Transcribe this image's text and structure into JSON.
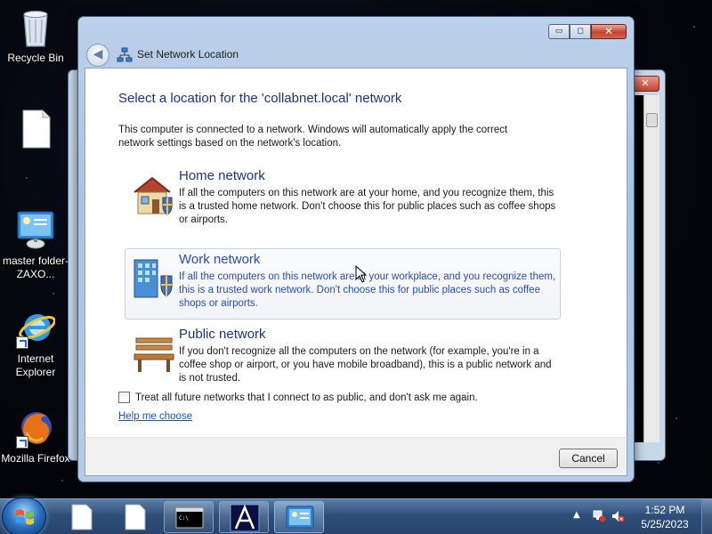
{
  "desktop": {
    "icons": [
      {
        "label": "Recycle Bin",
        "icon": "recycle-bin-icon"
      },
      {
        "label": "",
        "icon": "file-icon"
      },
      {
        "label": "master folder-ZAXO...",
        "icon": "network-folder-icon"
      },
      {
        "label": "Internet Explorer",
        "icon": "internet-explorer-icon"
      },
      {
        "label": "Mozilla Firefox",
        "icon": "firefox-icon"
      }
    ]
  },
  "background_window": {
    "close_label": "✕"
  },
  "dialog": {
    "title": "Set Network Location",
    "heading": "Select a location for the 'collabnet.local' network",
    "intro": "This computer is connected to a network. Windows will automatically apply the correct network settings based on the network's location.",
    "options": [
      {
        "title": "Home network",
        "description": "If all the computers on this network are at your home, and you recognize them, this is a trusted home network.  Don't choose this for public places such as coffee shops or airports.",
        "icon": "home-network-icon"
      },
      {
        "title": "Work network",
        "description": "If all the computers on this network are at your workplace, and you recognize them, this is a trusted work network.  Don't choose this for public places such as coffee shops or airports.",
        "icon": "work-network-icon",
        "state": "hover"
      },
      {
        "title": "Public network",
        "description": "If you don't recognize all the computers on the network (for example, you're in a coffee shop or airport, or you have mobile broadband), this is a public network and is not trusted.",
        "icon": "public-network-icon"
      }
    ],
    "checkbox_label": "Treat all future networks that I connect to as public, and don't ask me again.",
    "checkbox_checked": false,
    "help_link": "Help me choose",
    "cancel_label": "Cancel",
    "window_buttons": {
      "minimize": "▭",
      "maximize": "◻",
      "close": "✕"
    }
  },
  "taskbar": {
    "items": [
      {
        "name": "notepad-1",
        "icon": "document-icon"
      },
      {
        "name": "notepad-2",
        "icon": "document-icon"
      },
      {
        "name": "command-prompt",
        "icon": "console-icon"
      },
      {
        "name": "app-a",
        "icon": "a-app-icon"
      },
      {
        "name": "network-sharing",
        "icon": "network-control-panel-icon"
      }
    ],
    "clock_time": "1:52 PM",
    "clock_date": "5/25/2023"
  },
  "colors": {
    "heading_blue": "#1e3287",
    "link_blue": "#1e50c8",
    "hover_text": "#2c4bb5"
  }
}
